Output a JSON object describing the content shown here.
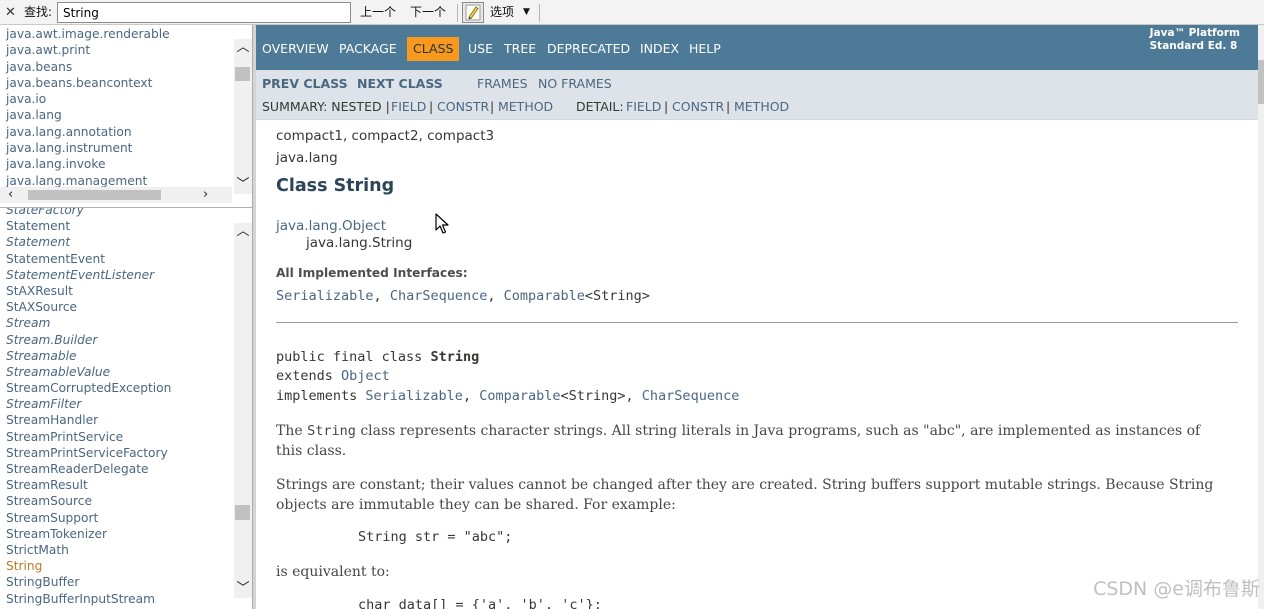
{
  "find_bar": {
    "close": "✕",
    "label": "查找:",
    "value": "String",
    "prev": "上一个",
    "next": "下一个",
    "options": "选项",
    "options_caret": "▼"
  },
  "packages": [
    "java.awt.image.renderable",
    "java.awt.print",
    "java.beans",
    "java.beans.beancontext",
    "java.io",
    "java.lang",
    "java.lang.annotation",
    "java.lang.instrument",
    "java.lang.invoke",
    "java.lang.management"
  ],
  "classes": [
    {
      "name": "StateFactory",
      "interface": true
    },
    {
      "name": "Statement",
      "interface": false
    },
    {
      "name": "Statement",
      "interface": true
    },
    {
      "name": "StatementEvent",
      "interface": false
    },
    {
      "name": "StatementEventListener",
      "interface": true
    },
    {
      "name": "StAXResult",
      "interface": false
    },
    {
      "name": "StAXSource",
      "interface": false
    },
    {
      "name": "Stream",
      "interface": true
    },
    {
      "name": "Stream.Builder",
      "interface": true
    },
    {
      "name": "Streamable",
      "interface": true
    },
    {
      "name": "StreamableValue",
      "interface": true
    },
    {
      "name": "StreamCorruptedException",
      "interface": false
    },
    {
      "name": "StreamFilter",
      "interface": true
    },
    {
      "name": "StreamHandler",
      "interface": false
    },
    {
      "name": "StreamPrintService",
      "interface": false
    },
    {
      "name": "StreamPrintServiceFactory",
      "interface": false
    },
    {
      "name": "StreamReaderDelegate",
      "interface": false
    },
    {
      "name": "StreamResult",
      "interface": false
    },
    {
      "name": "StreamSource",
      "interface": false
    },
    {
      "name": "StreamSupport",
      "interface": false
    },
    {
      "name": "StreamTokenizer",
      "interface": false
    },
    {
      "name": "StrictMath",
      "interface": false
    },
    {
      "name": "String",
      "interface": false,
      "current": true
    },
    {
      "name": "StringBuffer",
      "interface": false
    },
    {
      "name": "StringBufferInputStream",
      "interface": false
    }
  ],
  "top_nav": {
    "items": [
      "OVERVIEW",
      "PACKAGE",
      "CLASS",
      "USE",
      "TREE",
      "DEPRECATED",
      "INDEX",
      "HELP"
    ],
    "active": "CLASS",
    "platform_line1": "Java™ Platform",
    "platform_line2": "Standard Ed. 8"
  },
  "sub_nav": {
    "prev_class": "PREV CLASS",
    "next_class": "NEXT CLASS",
    "frames": "FRAMES",
    "no_frames": "NO FRAMES",
    "summary_label": "SUMMARY: NESTED |",
    "summary_field": "FIELD",
    "sep1": "|",
    "summary_constr": "CONSTR",
    "sep2": "|",
    "summary_method": "METHOD",
    "detail_label": "DETAIL:",
    "detail_field": "FIELD",
    "sep3": "|",
    "detail_constr": "CONSTR",
    "sep4": "|",
    "detail_method": "METHOD"
  },
  "content": {
    "profiles": "compact1, compact2, compact3",
    "package": "java.lang",
    "title": "Class String",
    "hierarchy_parent": "java.lang.Object",
    "hierarchy_child": "java.lang.String",
    "impl_label": "All Implemented Interfaces:",
    "impl_serializable": "Serializable",
    "impl_sep1": ", ",
    "impl_charsequence": "CharSequence",
    "impl_sep2": ", ",
    "impl_comparable": "Comparable",
    "impl_generic": "<String>",
    "decl_prefix": "public final class ",
    "decl_name": "String",
    "extends_kw": "extends ",
    "extends_type": "Object",
    "implements_kw": "implements ",
    "implements_serializable": "Serializable",
    "implements_sep1": ", ",
    "implements_comparable": "Comparable",
    "implements_generic": "<String>",
    "implements_sep2": ", ",
    "implements_charsequence": "CharSequence",
    "p1_a": "The ",
    "p1_code": "String",
    "p1_b": " class represents character strings. All string literals in Java programs, such as \"abc\", are implemented as instances of this class.",
    "p2": "Strings are constant; their values cannot be changed after they are created. String buffers support mutable strings. Because String objects are immutable they can be shared. For example:",
    "code1": "String str = \"abc\";",
    "p3": "is equivalent to:",
    "code2": "char data[] = {'a', 'b', 'c'};"
  },
  "watermark": "CSDN @e调布鲁斯"
}
